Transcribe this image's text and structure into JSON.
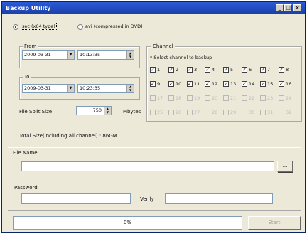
{
  "window": {
    "title": "Backup Utility"
  },
  "format": {
    "sec_label": "sec (x64 type)",
    "avi_label": "avi (compressed in DVD)",
    "selected": "sec"
  },
  "from": {
    "label": "From",
    "date": "2009-03-31",
    "time": "10:13:35"
  },
  "to": {
    "label": "To",
    "date": "2009-03-31",
    "time": "10:23:35"
  },
  "split": {
    "label": "File Split Size",
    "value": "750",
    "unit": "Mbytes"
  },
  "total_size_text": "Total Size(including all channel) : 86GM",
  "channel": {
    "title": "Channel",
    "hint": "* Select channel to backup",
    "rows": [
      {
        "labels": [
          "1",
          "2",
          "3",
          "4",
          "5",
          "6",
          "7",
          "8"
        ],
        "checked": true,
        "enabled": true
      },
      {
        "labels": [
          "9",
          "10",
          "11",
          "12",
          "13",
          "14",
          "15",
          "16"
        ],
        "checked": true,
        "enabled": true
      },
      {
        "labels": [
          "17",
          "18",
          "19",
          "20",
          "21",
          "22",
          "23",
          "24"
        ],
        "checked": false,
        "enabled": false
      },
      {
        "labels": [
          "25",
          "26",
          "27",
          "28",
          "29",
          "30",
          "31",
          "32"
        ],
        "checked": false,
        "enabled": false
      }
    ]
  },
  "file_name": {
    "label": "File Name",
    "value": "",
    "browse_label": "..."
  },
  "password": {
    "label": "Password",
    "value": "",
    "verify_label": "Verify",
    "verify_value": ""
  },
  "progress": {
    "text": "0%",
    "value": 0
  },
  "start_button_label": "Start"
}
